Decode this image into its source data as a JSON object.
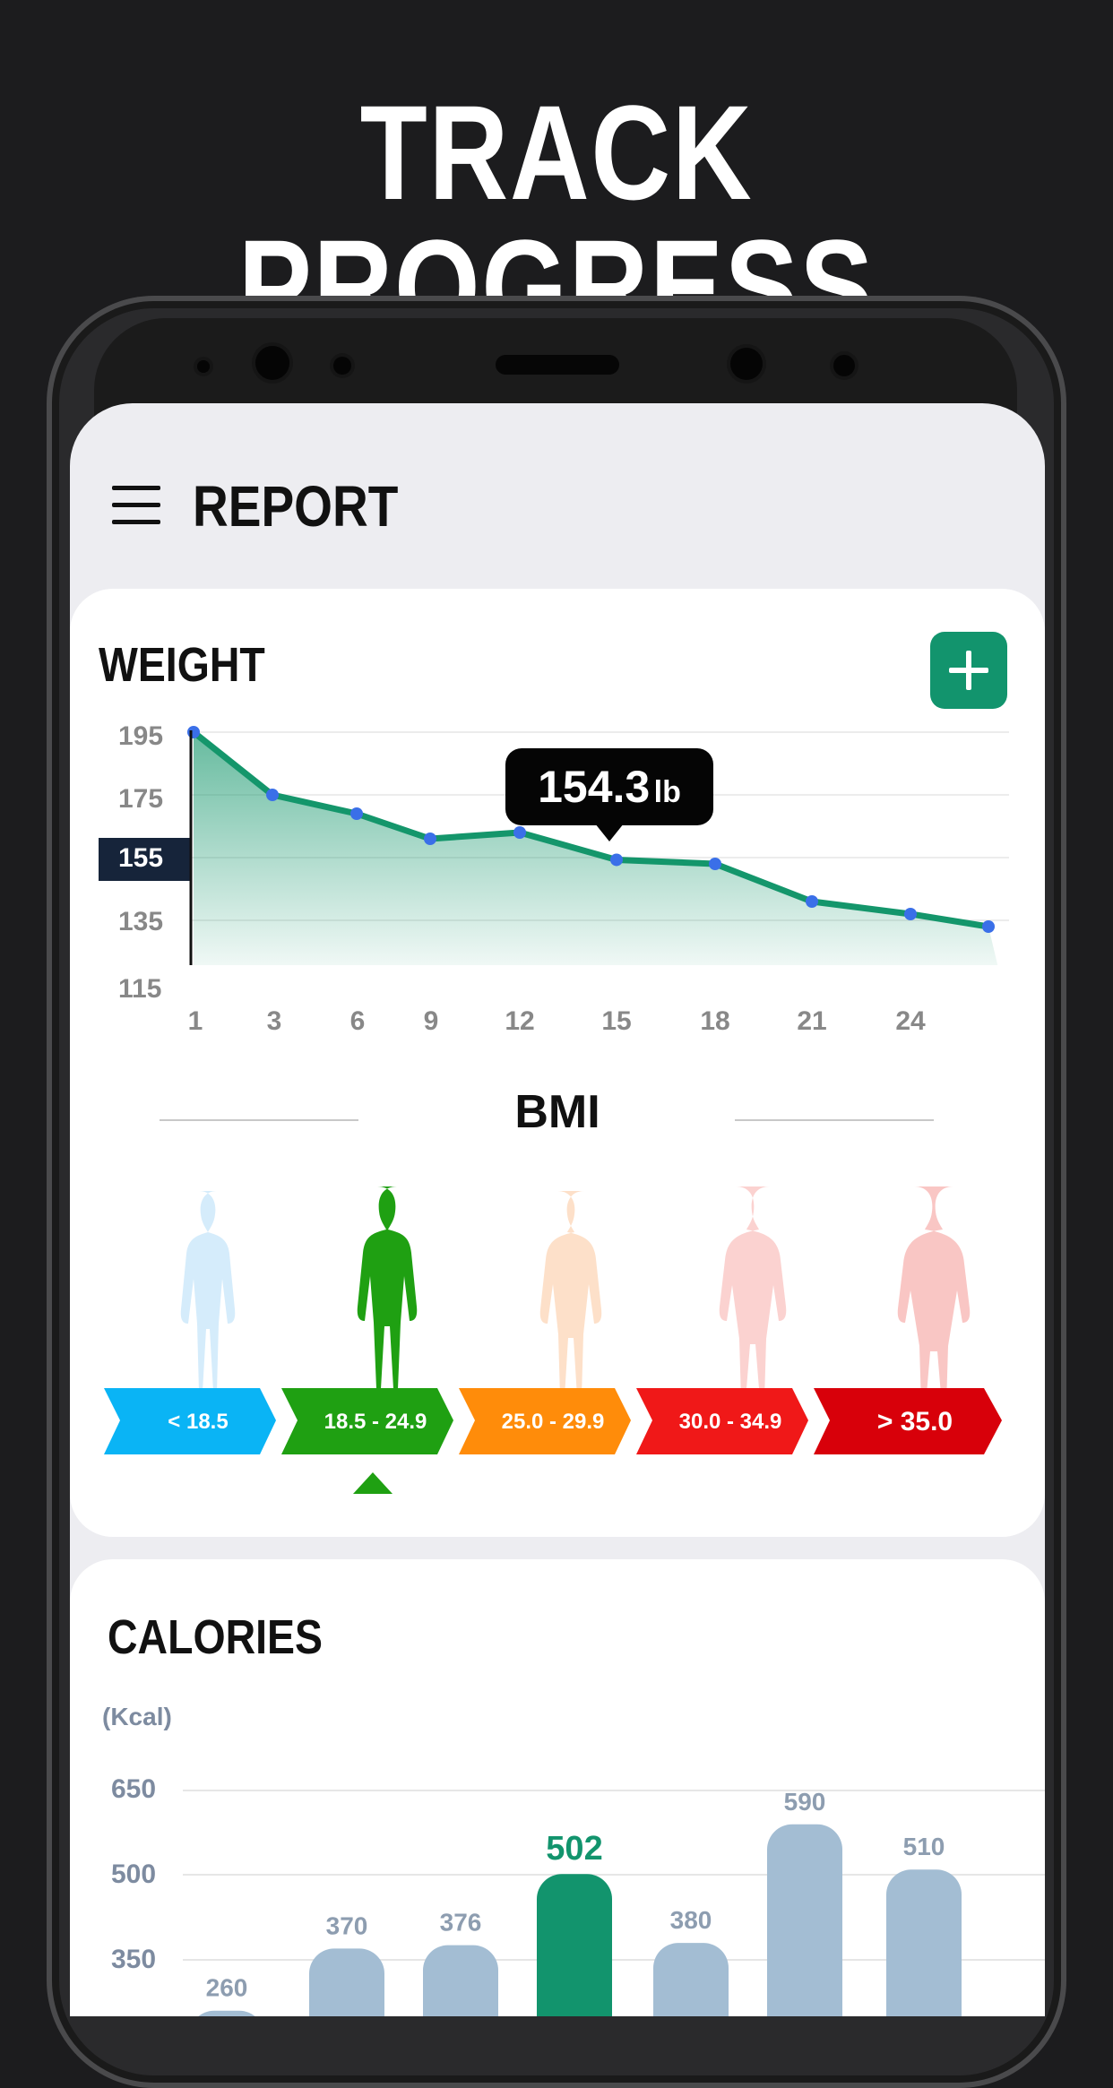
{
  "headline": "TRACK PROGRESS",
  "app": {
    "title": "REPORT"
  },
  "weight": {
    "title": "WEIGHT",
    "y_ticks": [
      "195",
      "175",
      "155",
      "135",
      "115"
    ],
    "highlight_tick": "155",
    "x_ticks": [
      "1",
      "3",
      "6",
      "9",
      "12",
      "15",
      "18",
      "21",
      "24"
    ],
    "tooltip_value": "154.3",
    "tooltip_unit": "lb"
  },
  "bmi": {
    "title": "BMI",
    "ranges": [
      {
        "label": "< 18.5",
        "color": "#0ab4f5"
      },
      {
        "label": "18.5 - 24.9",
        "color": "#1fa012"
      },
      {
        "label": "25.0 - 29.9",
        "color": "#ff8c0a"
      },
      {
        "label": "30.0 - 34.9",
        "color": "#f01818"
      },
      {
        "label": "> 35.0",
        "color": "#d8000a"
      }
    ],
    "selected_index": 1
  },
  "calories": {
    "title": "CALORIES",
    "unit": "(Kcal)",
    "y_ticks": [
      "650",
      "500",
      "350"
    ],
    "bar_labels": [
      "260",
      "370",
      "376",
      "502",
      "380",
      "590",
      "510"
    ]
  },
  "chart_data": [
    {
      "type": "line",
      "title": "WEIGHT",
      "x": [
        1,
        3,
        6,
        9,
        12,
        15,
        18,
        21,
        24,
        26
      ],
      "y": [
        195,
        175,
        169,
        161,
        163,
        154.3,
        153,
        141,
        137,
        133
      ],
      "xlabel": "",
      "ylabel": "",
      "ylim": [
        115,
        195
      ],
      "line_color": "#14966b",
      "point_color": "#3a6fe8"
    },
    {
      "type": "bar",
      "title": "CALORIES",
      "categories": [
        "",
        "",
        "",
        "",
        "",
        "",
        ""
      ],
      "values": [
        260,
        370,
        376,
        502,
        380,
        590,
        510
      ],
      "ylabel": "(Kcal)",
      "y_ticks": [
        350,
        500,
        650
      ],
      "highlight_index": 3,
      "bar_color": "#a3bdd3",
      "highlight_color": "#12946d"
    }
  ]
}
